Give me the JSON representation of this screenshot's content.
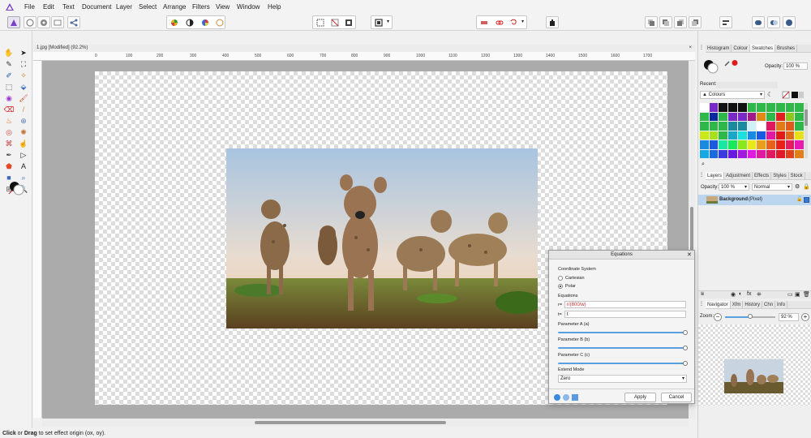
{
  "menubar": {
    "logo_icon": "affinity-logo-icon",
    "items": [
      "File",
      "Edit",
      "Text",
      "Document",
      "Layer",
      "Select",
      "Arrange",
      "Filters",
      "View",
      "Window",
      "Help"
    ]
  },
  "document": {
    "tab_title": "1.jpg [Modified] (92.2%)",
    "ruler_labels": [
      "0",
      "100",
      "200",
      "300",
      "400",
      "500",
      "600",
      "700",
      "800",
      "900",
      "1000",
      "1100",
      "1200",
      "1300",
      "1400",
      "1500",
      "1600",
      "1700"
    ]
  },
  "status": {
    "click": "Click",
    "or": " or ",
    "drag": "Drag",
    "rest": " to set effect origin (ox, oy)."
  },
  "right_panel": {
    "top_tabs": [
      "Histogram",
      "Colour",
      "Swatches",
      "Brushes"
    ],
    "active_top_tab": "Swatches",
    "opacity_label": "Opacity:",
    "opacity_value": "100 %",
    "recent_label": "Recent:",
    "palette_name": "Colours",
    "swatch_colors": [
      "#ffffff",
      "#7a28c8",
      "#111111",
      "#111111",
      "#111111",
      "#2fb84a",
      "#2fb84a",
      "#2fb84a",
      "#2fb84a",
      "#2fb84a",
      "#2fb84a",
      "#2fb84a",
      "#0a2aa0",
      "#2fb84a",
      "#7a28c8",
      "#7a28c8",
      "#a01a8a",
      "#e08a1a",
      "#2fb84a",
      "#e02020",
      "#8ac81a",
      "#2fb84a",
      "#2fb84a",
      "#2fb84a",
      "#2fb84a",
      "#1a8aa0",
      "#1a8aa0",
      "#d0f0f8",
      "#ffffff",
      "#e01a60",
      "#e07a1a",
      "#e05a1a",
      "#2fb84a",
      "#c8e81a",
      "#a8e01a",
      "#2fb84a",
      "#1aa8c8",
      "#1ae0e0",
      "#1a8ae0",
      "#1a5ae0",
      "#e01aa0",
      "#e01a1a",
      "#e06a1a",
      "#e8e01a",
      "#1a8ae0",
      "#1a5ae0",
      "#1ae8a0",
      "#1ae85a",
      "#8ae81a",
      "#e8e81a",
      "#e8a01a",
      "#e8601a",
      "#e8201a",
      "#e81a60",
      "#e81ab0",
      "#1aa8e0",
      "#1a6ae0",
      "#3a3ae0",
      "#6a1ae0",
      "#a01ae0",
      "#e01ae0",
      "#e01aa0",
      "#e01a60",
      "#e01a2a",
      "#e0401a",
      "#e0801a"
    ],
    "layers_tabs": [
      "Layers",
      "Adjustment",
      "Effects",
      "Styles",
      "Stock"
    ],
    "active_layers_tab": "Layers",
    "layers_opacity_label": "Opacity:",
    "layers_opacity_value": "100 %",
    "blend_mode": "Normal",
    "layer_name": "Background",
    "layer_type": "(Pixel)",
    "nav_tabs": [
      "Navigator",
      "Xfm",
      "History",
      "Chn",
      "Info"
    ],
    "active_nav_tab": "Navigator",
    "zoom_label": "Zoom:",
    "zoom_value": "92 %",
    "zoom_level": 0.5
  },
  "dialog": {
    "title": "Equations",
    "coord_system_label": "Coordinate System",
    "cartesian_label": "Cartesian",
    "polar_label": "Polar",
    "selected_system": "Polar",
    "equations_label": "Equations",
    "r_label": "r=",
    "r_value": "r/(800/w)",
    "t_label": "t=",
    "t_value": "t",
    "param_a_label": "Parameter A (a)",
    "param_b_label": "Parameter B (b)",
    "param_c_label": "Parameter C (c)",
    "param_a": 1.0,
    "param_b": 1.0,
    "param_c": 1.0,
    "extend_mode_label": "Extend Mode",
    "extend_mode_value": "Zero",
    "apply_label": "Apply",
    "cancel_label": "Cancel"
  }
}
